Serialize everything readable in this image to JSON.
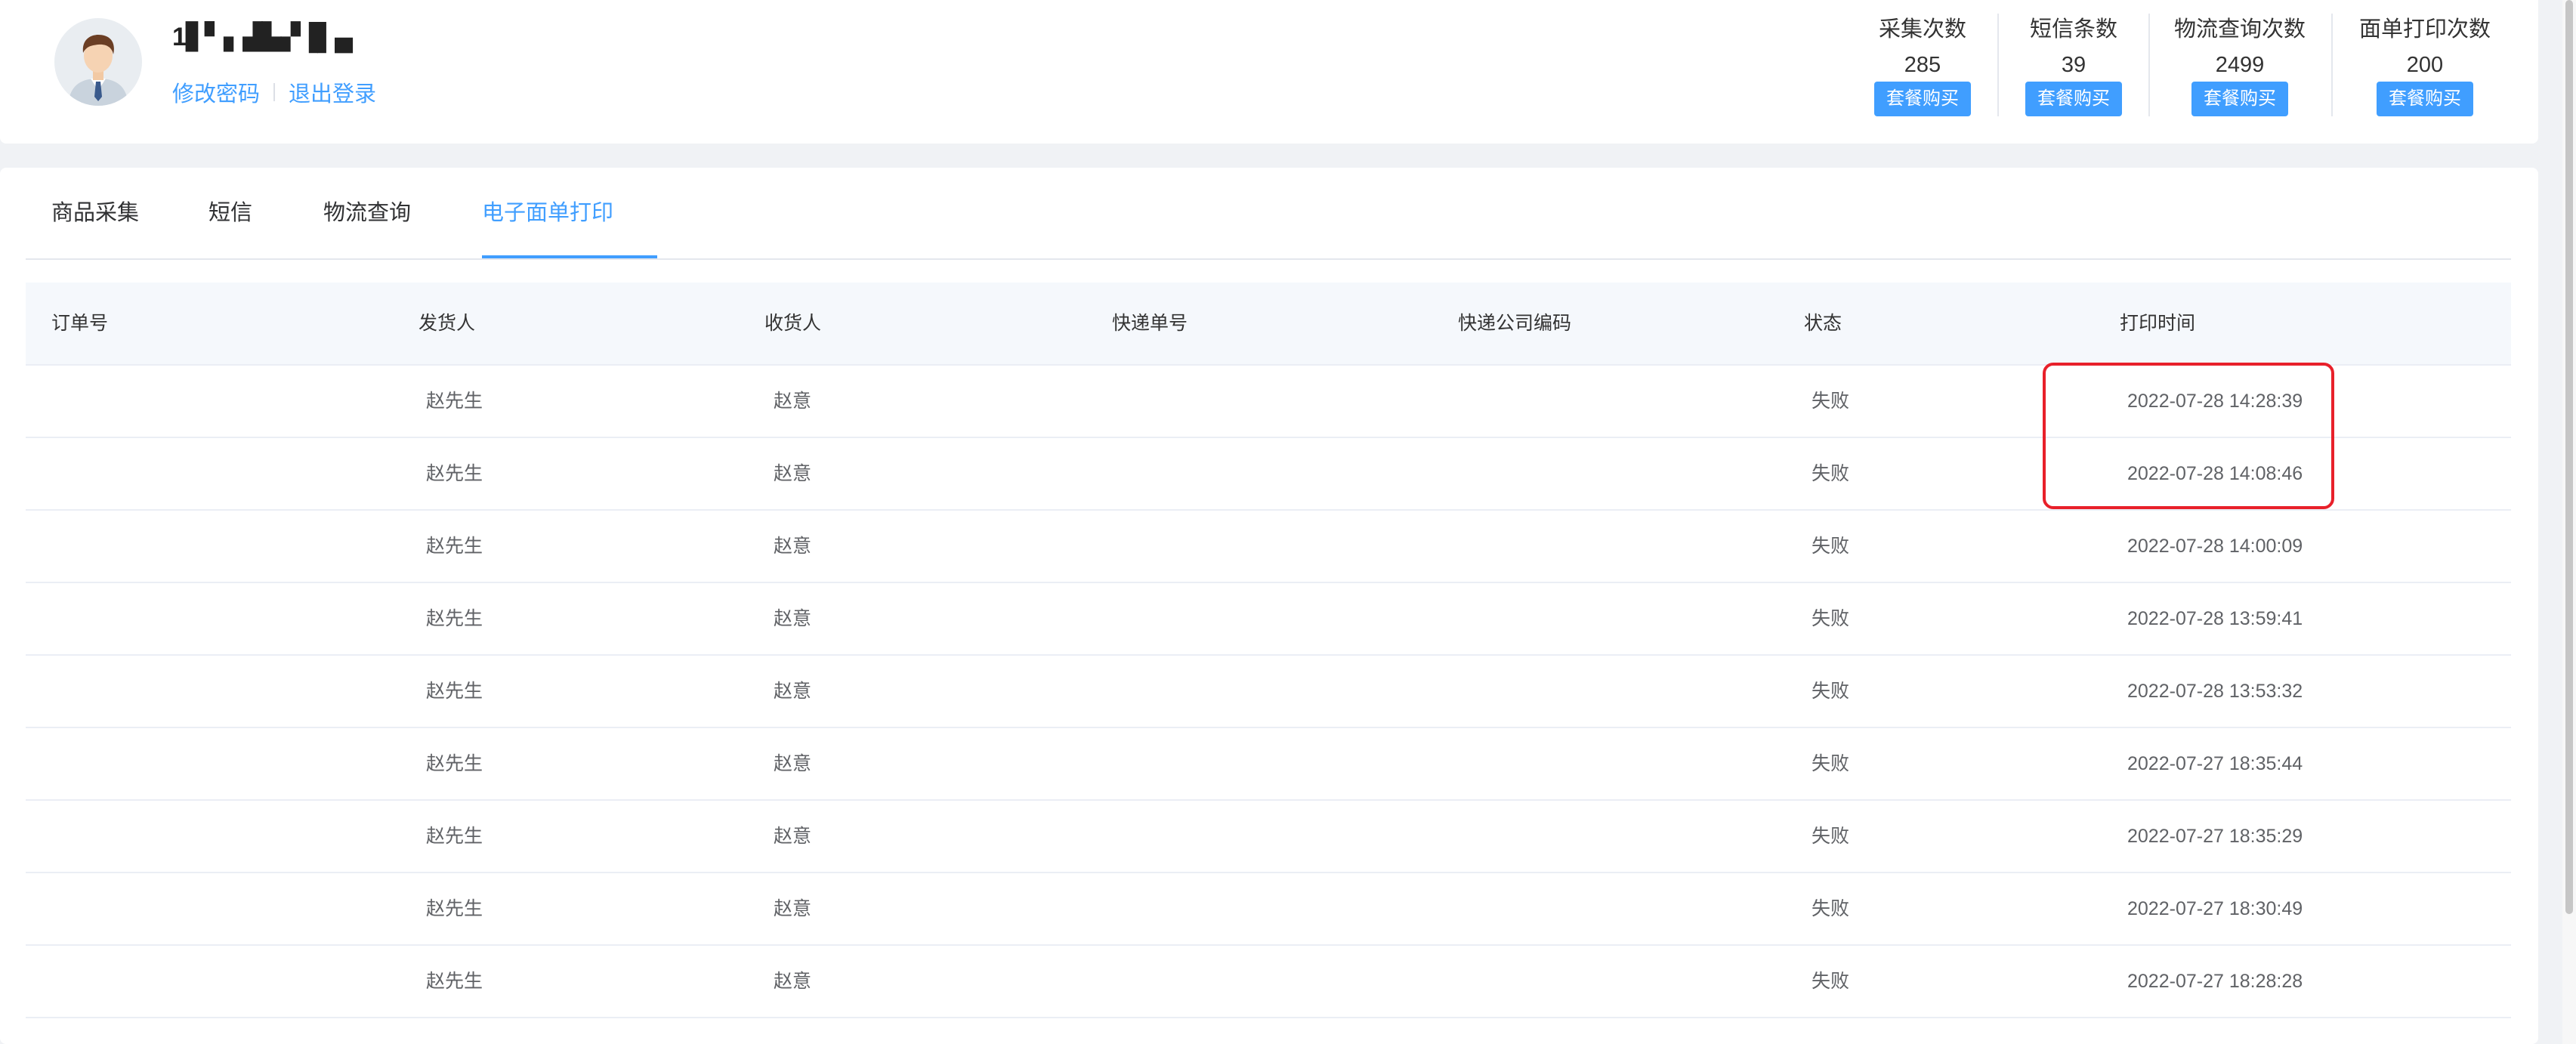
{
  "user": {
    "name": "1▋▘▖▟▙▞▐▌▄",
    "change_password": "修改密码",
    "logout": "退出登录"
  },
  "stats": [
    {
      "label": "采集次数",
      "value": "285",
      "button": "套餐购买"
    },
    {
      "label": "短信条数",
      "value": "39",
      "button": "套餐购买"
    },
    {
      "label": "物流查询次数",
      "value": "2499",
      "button": "套餐购买"
    },
    {
      "label": "面单打印次数",
      "value": "200",
      "button": "套餐购买"
    }
  ],
  "tabs": [
    "商品采集",
    "短信",
    "物流查询",
    "电子面单打印"
  ],
  "active_tab": 3,
  "table": {
    "columns": [
      "订单号",
      "发货人",
      "收货人",
      "快递单号",
      "快递公司编码",
      "状态",
      "打印时间"
    ],
    "rows": [
      {
        "order_no": "",
        "sender": "赵先生",
        "receiver": "赵意",
        "tracking_no": "",
        "company_code": "",
        "status": "失败",
        "print_time": "2022-07-28 14:28:39"
      },
      {
        "order_no": "",
        "sender": "赵先生",
        "receiver": "赵意",
        "tracking_no": "",
        "company_code": "",
        "status": "失败",
        "print_time": "2022-07-28 14:08:46"
      },
      {
        "order_no": "",
        "sender": "赵先生",
        "receiver": "赵意",
        "tracking_no": "",
        "company_code": "",
        "status": "失败",
        "print_time": "2022-07-28 14:00:09"
      },
      {
        "order_no": "",
        "sender": "赵先生",
        "receiver": "赵意",
        "tracking_no": "",
        "company_code": "",
        "status": "失败",
        "print_time": "2022-07-28 13:59:41"
      },
      {
        "order_no": "",
        "sender": "赵先生",
        "receiver": "赵意",
        "tracking_no": "",
        "company_code": "",
        "status": "失败",
        "print_time": "2022-07-28 13:53:32"
      },
      {
        "order_no": "",
        "sender": "赵先生",
        "receiver": "赵意",
        "tracking_no": "",
        "company_code": "",
        "status": "失败",
        "print_time": "2022-07-27 18:35:44"
      },
      {
        "order_no": "",
        "sender": "赵先生",
        "receiver": "赵意",
        "tracking_no": "",
        "company_code": "",
        "status": "失败",
        "print_time": "2022-07-27 18:35:29"
      },
      {
        "order_no": "",
        "sender": "赵先生",
        "receiver": "赵意",
        "tracking_no": "",
        "company_code": "",
        "status": "失败",
        "print_time": "2022-07-27 18:30:49"
      },
      {
        "order_no": "",
        "sender": "赵先生",
        "receiver": "赵意",
        "tracking_no": "",
        "company_code": "",
        "status": "失败",
        "print_time": "2022-07-27 18:28:28"
      }
    ]
  },
  "colors": {
    "accent": "#409eff",
    "highlight": "#e8202a"
  },
  "icons": {
    "avatar": "businessman-avatar-icon"
  }
}
